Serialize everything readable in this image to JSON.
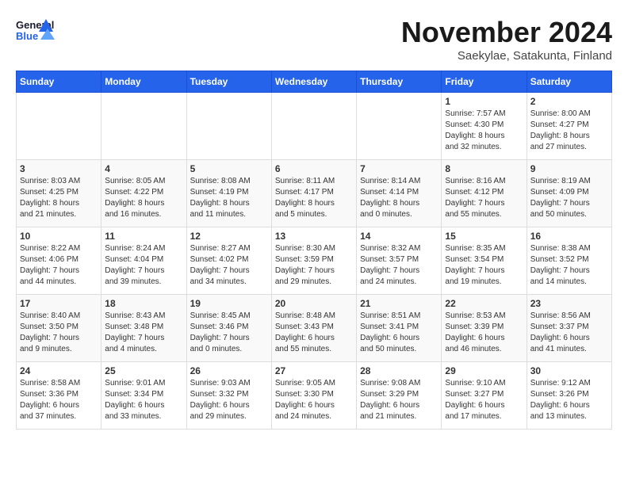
{
  "header": {
    "logo_general": "General",
    "logo_blue": "Blue",
    "month_title": "November 2024",
    "location": "Saekylae, Satakunta, Finland"
  },
  "days_of_week": [
    "Sunday",
    "Monday",
    "Tuesday",
    "Wednesday",
    "Thursday",
    "Friday",
    "Saturday"
  ],
  "weeks": [
    [
      {
        "day": "",
        "info": ""
      },
      {
        "day": "",
        "info": ""
      },
      {
        "day": "",
        "info": ""
      },
      {
        "day": "",
        "info": ""
      },
      {
        "day": "",
        "info": ""
      },
      {
        "day": "1",
        "info": "Sunrise: 7:57 AM\nSunset: 4:30 PM\nDaylight: 8 hours\nand 32 minutes."
      },
      {
        "day": "2",
        "info": "Sunrise: 8:00 AM\nSunset: 4:27 PM\nDaylight: 8 hours\nand 27 minutes."
      }
    ],
    [
      {
        "day": "3",
        "info": "Sunrise: 8:03 AM\nSunset: 4:25 PM\nDaylight: 8 hours\nand 21 minutes."
      },
      {
        "day": "4",
        "info": "Sunrise: 8:05 AM\nSunset: 4:22 PM\nDaylight: 8 hours\nand 16 minutes."
      },
      {
        "day": "5",
        "info": "Sunrise: 8:08 AM\nSunset: 4:19 PM\nDaylight: 8 hours\nand 11 minutes."
      },
      {
        "day": "6",
        "info": "Sunrise: 8:11 AM\nSunset: 4:17 PM\nDaylight: 8 hours\nand 5 minutes."
      },
      {
        "day": "7",
        "info": "Sunrise: 8:14 AM\nSunset: 4:14 PM\nDaylight: 8 hours\nand 0 minutes."
      },
      {
        "day": "8",
        "info": "Sunrise: 8:16 AM\nSunset: 4:12 PM\nDaylight: 7 hours\nand 55 minutes."
      },
      {
        "day": "9",
        "info": "Sunrise: 8:19 AM\nSunset: 4:09 PM\nDaylight: 7 hours\nand 50 minutes."
      }
    ],
    [
      {
        "day": "10",
        "info": "Sunrise: 8:22 AM\nSunset: 4:06 PM\nDaylight: 7 hours\nand 44 minutes."
      },
      {
        "day": "11",
        "info": "Sunrise: 8:24 AM\nSunset: 4:04 PM\nDaylight: 7 hours\nand 39 minutes."
      },
      {
        "day": "12",
        "info": "Sunrise: 8:27 AM\nSunset: 4:02 PM\nDaylight: 7 hours\nand 34 minutes."
      },
      {
        "day": "13",
        "info": "Sunrise: 8:30 AM\nSunset: 3:59 PM\nDaylight: 7 hours\nand 29 minutes."
      },
      {
        "day": "14",
        "info": "Sunrise: 8:32 AM\nSunset: 3:57 PM\nDaylight: 7 hours\nand 24 minutes."
      },
      {
        "day": "15",
        "info": "Sunrise: 8:35 AM\nSunset: 3:54 PM\nDaylight: 7 hours\nand 19 minutes."
      },
      {
        "day": "16",
        "info": "Sunrise: 8:38 AM\nSunset: 3:52 PM\nDaylight: 7 hours\nand 14 minutes."
      }
    ],
    [
      {
        "day": "17",
        "info": "Sunrise: 8:40 AM\nSunset: 3:50 PM\nDaylight: 7 hours\nand 9 minutes."
      },
      {
        "day": "18",
        "info": "Sunrise: 8:43 AM\nSunset: 3:48 PM\nDaylight: 7 hours\nand 4 minutes."
      },
      {
        "day": "19",
        "info": "Sunrise: 8:45 AM\nSunset: 3:46 PM\nDaylight: 7 hours\nand 0 minutes."
      },
      {
        "day": "20",
        "info": "Sunrise: 8:48 AM\nSunset: 3:43 PM\nDaylight: 6 hours\nand 55 minutes."
      },
      {
        "day": "21",
        "info": "Sunrise: 8:51 AM\nSunset: 3:41 PM\nDaylight: 6 hours\nand 50 minutes."
      },
      {
        "day": "22",
        "info": "Sunrise: 8:53 AM\nSunset: 3:39 PM\nDaylight: 6 hours\nand 46 minutes."
      },
      {
        "day": "23",
        "info": "Sunrise: 8:56 AM\nSunset: 3:37 PM\nDaylight: 6 hours\nand 41 minutes."
      }
    ],
    [
      {
        "day": "24",
        "info": "Sunrise: 8:58 AM\nSunset: 3:36 PM\nDaylight: 6 hours\nand 37 minutes."
      },
      {
        "day": "25",
        "info": "Sunrise: 9:01 AM\nSunset: 3:34 PM\nDaylight: 6 hours\nand 33 minutes."
      },
      {
        "day": "26",
        "info": "Sunrise: 9:03 AM\nSunset: 3:32 PM\nDaylight: 6 hours\nand 29 minutes."
      },
      {
        "day": "27",
        "info": "Sunrise: 9:05 AM\nSunset: 3:30 PM\nDaylight: 6 hours\nand 24 minutes."
      },
      {
        "day": "28",
        "info": "Sunrise: 9:08 AM\nSunset: 3:29 PM\nDaylight: 6 hours\nand 21 minutes."
      },
      {
        "day": "29",
        "info": "Sunrise: 9:10 AM\nSunset: 3:27 PM\nDaylight: 6 hours\nand 17 minutes."
      },
      {
        "day": "30",
        "info": "Sunrise: 9:12 AM\nSunset: 3:26 PM\nDaylight: 6 hours\nand 13 minutes."
      }
    ]
  ]
}
